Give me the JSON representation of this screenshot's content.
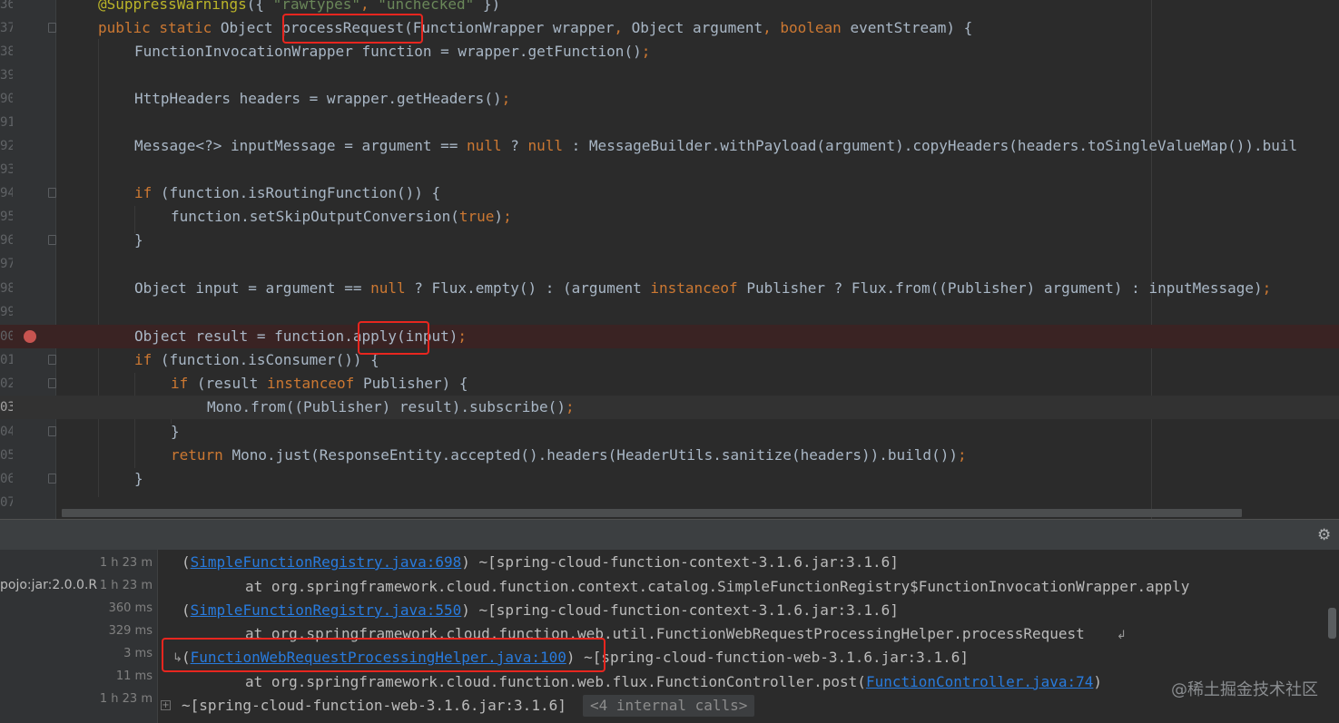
{
  "editor": {
    "lines": [
      {
        "num": "36",
        "tokens": [
          {
            "t": "@SuppressWarnings",
            "c": "an"
          },
          {
            "t": "({ "
          },
          {
            "t": "\"rawtypes\"",
            "c": "s"
          },
          {
            "t": ", ",
            "c": "k"
          },
          {
            "t": "\"unchecked\"",
            "c": "s"
          },
          {
            "t": " })"
          }
        ]
      },
      {
        "num": "37",
        "tokens": [
          {
            "t": "public static ",
            "c": "k"
          },
          {
            "t": "Object processRequest(FunctionWrapper wrapper"
          },
          {
            "t": ", ",
            "c": "k"
          },
          {
            "t": "Object argument"
          },
          {
            "t": ", ",
            "c": "k"
          },
          {
            "t": "boolean ",
            "c": "k"
          },
          {
            "t": "eventStream) {"
          }
        ]
      },
      {
        "num": "38",
        "tokens": [
          {
            "t": "FunctionInvocationWrapper function = wrapper.getFunction()"
          },
          {
            "t": ";",
            "c": "k"
          }
        ]
      },
      {
        "num": "39",
        "tokens": []
      },
      {
        "num": "90",
        "tokens": [
          {
            "t": "HttpHeaders headers = wrapper.getHeaders()"
          },
          {
            "t": ";",
            "c": "k"
          }
        ]
      },
      {
        "num": "91",
        "tokens": []
      },
      {
        "num": "92",
        "tokens": [
          {
            "t": "Message<?> inputMessage = argument == "
          },
          {
            "t": "null ",
            "c": "k"
          },
          {
            "t": "? "
          },
          {
            "t": "null ",
            "c": "k"
          },
          {
            "t": ": MessageBuilder.withPayload(argument).copyHeaders(headers.toSingleValueMap()).buil"
          }
        ]
      },
      {
        "num": "93",
        "tokens": []
      },
      {
        "num": "94",
        "tokens": [
          {
            "t": "if ",
            "c": "k"
          },
          {
            "t": "(function.isRoutingFunction()) {"
          }
        ]
      },
      {
        "num": "95",
        "tokens": [
          {
            "t": "function.setSkipOutputConversion("
          },
          {
            "t": "true",
            "c": "k"
          },
          {
            "t": ")"
          },
          {
            "t": ";",
            "c": "k"
          }
        ]
      },
      {
        "num": "96",
        "tokens": [
          {
            "t": "}"
          }
        ]
      },
      {
        "num": "97",
        "tokens": []
      },
      {
        "num": "98",
        "tokens": [
          {
            "t": "Object input = argument == "
          },
          {
            "t": "null ",
            "c": "k"
          },
          {
            "t": "? Flux.empty() : (argument "
          },
          {
            "t": "instanceof ",
            "c": "k"
          },
          {
            "t": "Publisher ? Flux.from((Publisher) argument) : inputMessage)"
          },
          {
            "t": ";",
            "c": "k"
          }
        ]
      },
      {
        "num": "99",
        "tokens": []
      },
      {
        "num": "00",
        "tokens": [
          {
            "t": "Object result = function.apply(input)"
          },
          {
            "t": ";",
            "c": "k"
          }
        ]
      },
      {
        "num": "01",
        "tokens": [
          {
            "t": "if ",
            "c": "k"
          },
          {
            "t": "(function.isConsumer()) {"
          }
        ]
      },
      {
        "num": "02",
        "tokens": [
          {
            "t": "if ",
            "c": "k"
          },
          {
            "t": "(result "
          },
          {
            "t": "instanceof ",
            "c": "k"
          },
          {
            "t": "Publisher) {"
          }
        ]
      },
      {
        "num": "03",
        "tokens": [
          {
            "t": "Mono.from((Publisher) result).subscribe()"
          },
          {
            "t": ";",
            "c": "k"
          }
        ]
      },
      {
        "num": "04",
        "tokens": [
          {
            "t": "}"
          }
        ]
      },
      {
        "num": "05",
        "tokens": [
          {
            "t": "return ",
            "c": "k"
          },
          {
            "t": "Mono.just(ResponseEntity.accepted().headers(HeaderUtils.sanitize(headers)).build())"
          },
          {
            "t": ";",
            "c": "k"
          }
        ]
      },
      {
        "num": "06",
        "tokens": [
          {
            "t": "}"
          }
        ]
      },
      {
        "num": "07",
        "tokens": []
      }
    ]
  },
  "panel": {
    "left": {
      "label": "pojo:jar:2.0.0.R",
      "durations": [
        "1 h 23 m",
        "1 h 23 m",
        "360 ms",
        "329 ms",
        "3 ms",
        "11 ms",
        "1 h 23 m"
      ]
    },
    "log": [
      [
        {
          "t": "("
        },
        {
          "t": "SimpleFunctionRegistry.java:698",
          "link": true
        },
        {
          "t": ") ~[spring-cloud-function-context-3.1.6.jar:3.1.6]"
        }
      ],
      [
        {
          "t": "at org.springframework.cloud.function.context.catalog.SimpleFunctionRegistry$FunctionInvocationWrapper.apply"
        }
      ],
      [
        {
          "t": "("
        },
        {
          "t": "SimpleFunctionRegistry.java:550",
          "link": true
        },
        {
          "t": ") ~[spring-cloud-function-context-3.1.6.jar:3.1.6]"
        }
      ],
      [
        {
          "t": "at org.springframework.cloud.function.web.util.FunctionWebRequestProcessingHelper.processRequest"
        }
      ],
      [
        {
          "t": "("
        },
        {
          "t": "FunctionWebRequestProcessingHelper.java:100",
          "link": true
        },
        {
          "t": ") ~[spring-cloud-function-web-3.1.6.jar:3.1.6]"
        }
      ],
      [
        {
          "t": "at org.springframework.cloud.function.web.flux.FunctionController.post("
        },
        {
          "t": "FunctionController.java:74",
          "link": true
        },
        {
          "t": ")"
        }
      ],
      [
        {
          "t": "~[spring-cloud-function-web-3.1.6.jar:3.1.6]"
        }
      ]
    ],
    "internal_calls": "<4 internal calls>",
    "watermark": "@稀土掘金技术社区",
    "icons": {
      "settings": "gear-icon",
      "expand": "plus-box-icon"
    }
  }
}
